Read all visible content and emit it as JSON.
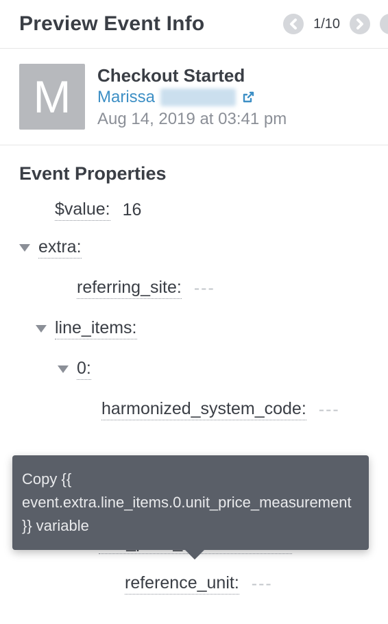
{
  "header": {
    "title": "Preview Event Info",
    "page_current": "1",
    "page_total": "10"
  },
  "event": {
    "avatar_letter": "M",
    "name": "Checkout Started",
    "user_first": "Marissa",
    "timestamp": "Aug 14, 2019 at 03:41 pm"
  },
  "section_title": "Event Properties",
  "props": {
    "value_key": "$value:",
    "value_val": "16",
    "extra_key": "extra:",
    "referring_site_key": "referring_site:",
    "referring_site_val": "---",
    "line_items_key": "line_items:",
    "idx0_key": "0:",
    "hsc_key": "harmonized_system_code:",
    "hsc_val": "---",
    "upm_key": "unit_price_measurement:",
    "ref_unit_key": "reference_unit:",
    "ref_unit_val": "---"
  },
  "tooltip": {
    "text": "Copy {{ event.extra.line_items.0.unit_price_measurement }} variable"
  }
}
